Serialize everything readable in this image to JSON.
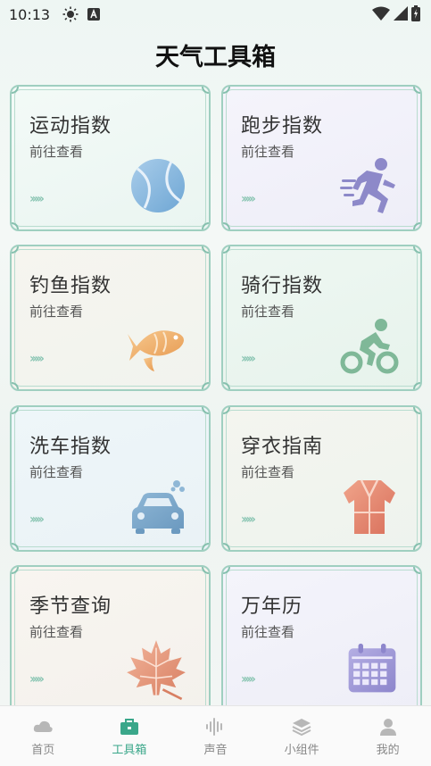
{
  "status": {
    "time": "10:13"
  },
  "title": "天气工具箱",
  "cards": [
    {
      "title": "运动指数",
      "sub": "前往查看",
      "arrows": "›››››"
    },
    {
      "title": "跑步指数",
      "sub": "前往查看",
      "arrows": "›››››"
    },
    {
      "title": "钓鱼指数",
      "sub": "前往查看",
      "arrows": "›››››"
    },
    {
      "title": "骑行指数",
      "sub": "前往查看",
      "arrows": "›››››"
    },
    {
      "title": "洗车指数",
      "sub": "前往查看",
      "arrows": "›››››"
    },
    {
      "title": "穿衣指南",
      "sub": "前往查看",
      "arrows": "›››››"
    },
    {
      "title": "季节查询",
      "sub": "前往查看",
      "arrows": "›››››"
    },
    {
      "title": "万年历",
      "sub": "前往查看",
      "arrows": "›››››"
    }
  ],
  "tabs": [
    {
      "label": "首页",
      "icon": "cloud-icon"
    },
    {
      "label": "工具箱",
      "icon": "toolbox-icon",
      "active": true
    },
    {
      "label": "声音",
      "icon": "sound-wave-icon"
    },
    {
      "label": "小组件",
      "icon": "layers-icon"
    },
    {
      "label": "我的",
      "icon": "person-icon"
    }
  ],
  "colors": {
    "accent": "#3aa78a",
    "card_border": "#9fcfc0"
  }
}
